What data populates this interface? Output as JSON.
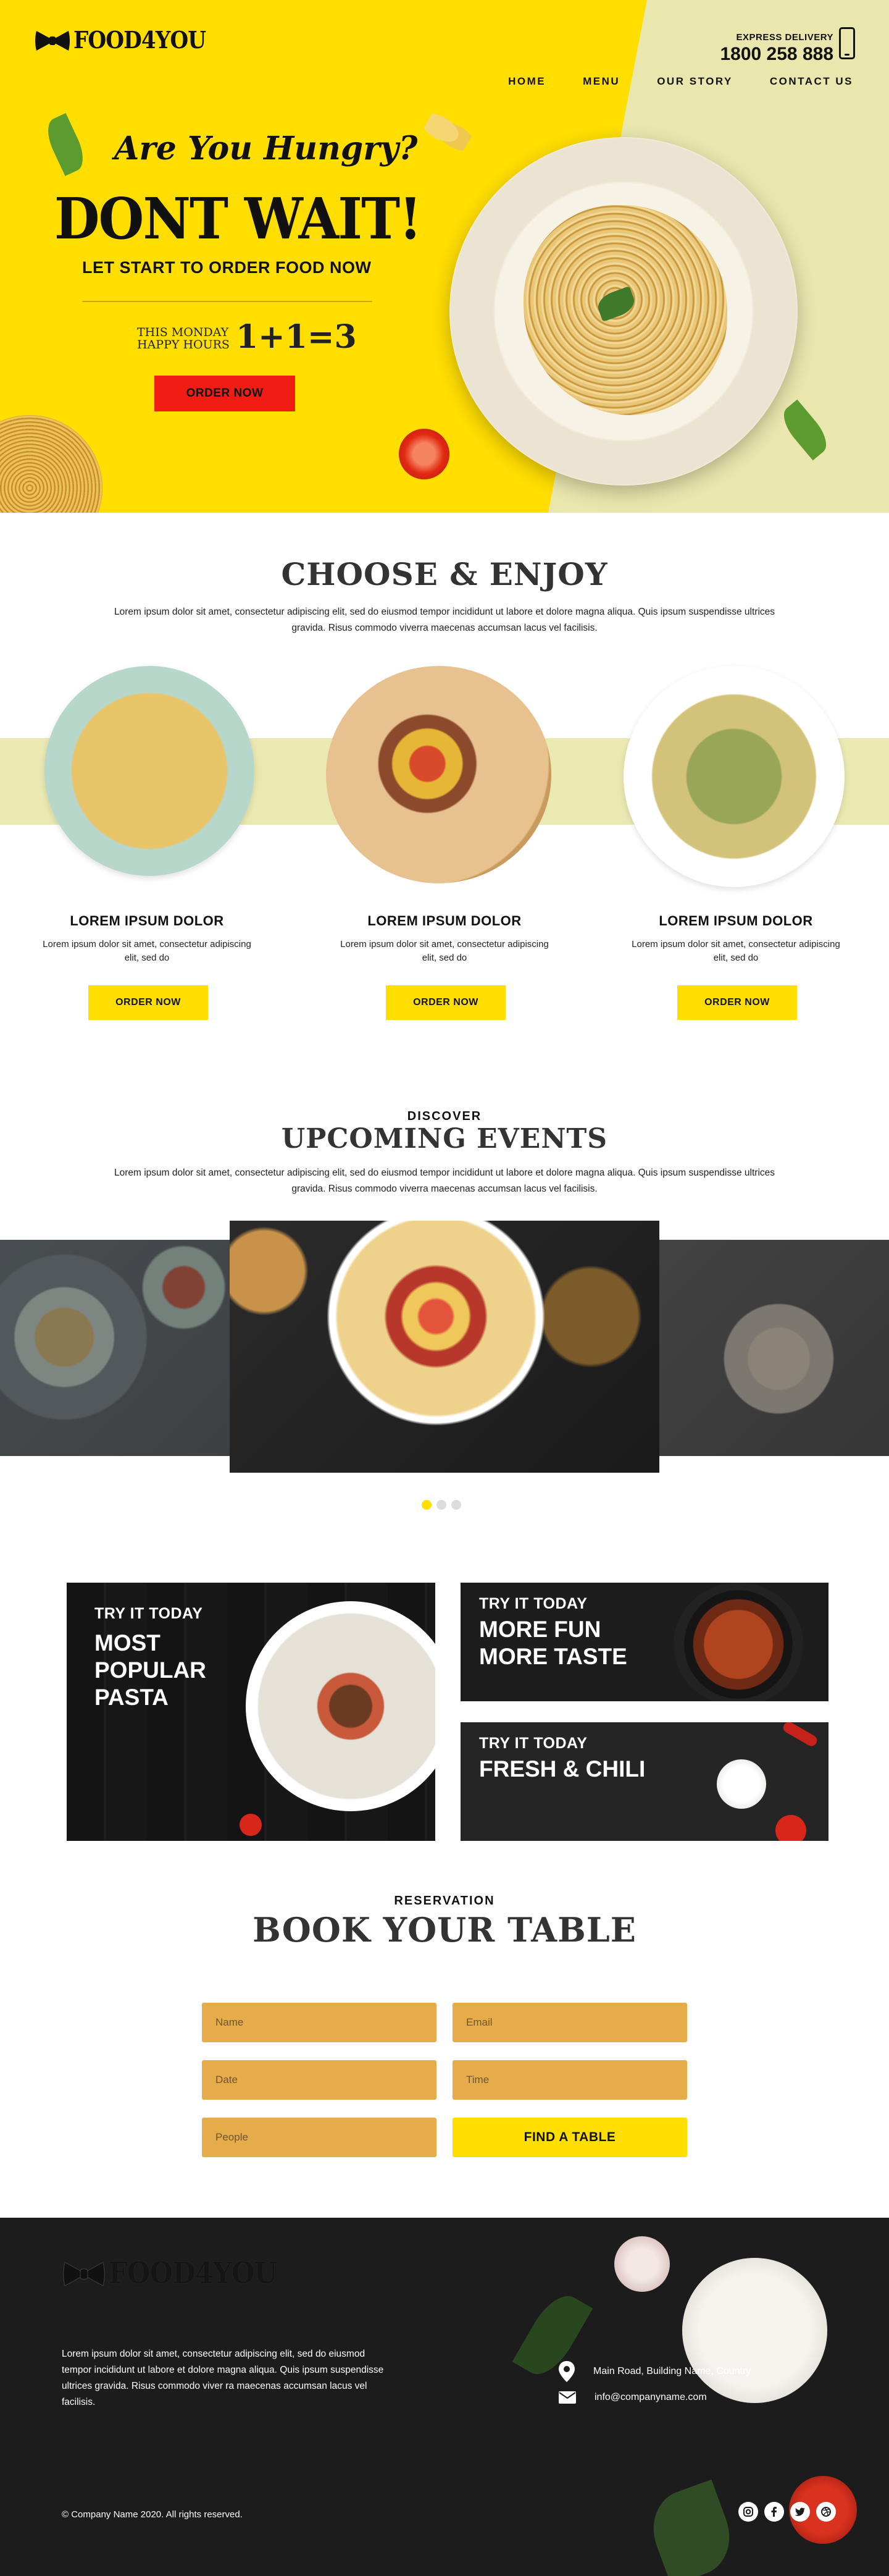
{
  "header": {
    "logo_text": "FOOD4YOU",
    "express_label": "EXPRESS DELIVERY",
    "express_phone": "1800 258 888",
    "nav": [
      "HOME",
      "MENU",
      "OUR STORY",
      "CONTACT US"
    ]
  },
  "hero": {
    "hungry": "Are You Hungry?",
    "dont_wait": "DONT WAIT!",
    "tagline": "LET START TO ORDER FOOD NOW",
    "monday_line1": "THIS MONDAY",
    "monday_line2": "HAPPY HOURS",
    "offer": "1+1=3",
    "button": "ORDER NOW"
  },
  "choose": {
    "title": "CHOOSE & ENJOY",
    "description": "Lorem ipsum dolor sit amet, consectetur adipiscing elit, sed do eiusmod tempor incididunt ut labore et dolore magna aliqua. Quis ipsum suspendisse ultrices gravida. Risus commodo viverra maecenas accumsan lacus vel facilisis.",
    "cards": [
      {
        "title": "LOREM IPSUM DOLOR",
        "description": "Lorem ipsum dolor sit amet, consectetur adipiscing elit, sed do",
        "button": "ORDER NOW"
      },
      {
        "title": "LOREM IPSUM DOLOR",
        "description": "Lorem ipsum dolor sit amet, consectetur adipiscing elit, sed do",
        "button": "ORDER NOW"
      },
      {
        "title": "LOREM IPSUM DOLOR",
        "description": "Lorem ipsum dolor sit amet, consectetur adipiscing elit, sed do",
        "button": "ORDER NOW"
      }
    ]
  },
  "events": {
    "kicker": "DISCOVER",
    "title": "UPCOMING EVENTS",
    "description": "Lorem ipsum dolor sit amet, consectetur adipiscing elit, sed do eiusmod tempor incididunt ut labore et dolore magna aliqua. Quis ipsum suspendisse ultrices gravida. Risus commodo viverra maecenas accumsan lacus vel facilisis."
  },
  "promos": {
    "pasta": {
      "kicker": "TRY IT TODAY",
      "line1": "MOST",
      "line2": "POPULAR",
      "line3": "PASTA"
    },
    "fun": {
      "kicker": "TRY IT TODAY",
      "line1": "MORE FUN",
      "line2": "MORE TASTE"
    },
    "chili": {
      "kicker": "TRY IT TODAY",
      "line1": "FRESH & CHILI"
    }
  },
  "reservation": {
    "kicker": "RESERVATION",
    "title": "BOOK YOUR TABLE",
    "name_placeholder": "Name",
    "email_placeholder": "Email",
    "date_placeholder": "Date",
    "time_placeholder": "Time",
    "people_placeholder": "People",
    "button": "FIND A TABLE"
  },
  "footer": {
    "logo_text": "FOOD4YOU",
    "description": "Lorem ipsum dolor sit amet, consectetur adipiscing elit, sed do eiusmod tempor incididunt ut labore et dolore magna aliqua. Quis ipsum suspendisse ultrices gravida. Risus commodo viver ra maecenas accumsan lacus vel facilisis.",
    "address": "Main Road, Building Name, Country",
    "email": "info@companyname.com",
    "copyright": "© Company Name 2020. All rights reserved.",
    "socials": [
      "instagram-icon",
      "facebook-icon",
      "twitter-icon",
      "dribbble-icon"
    ]
  },
  "colors": {
    "brand_yellow": "#ffde00",
    "hero_pale": "#e9e7ae",
    "accent_red": "#f11c13",
    "form_orange": "#e7ac4a",
    "dark": "#1c1c1c"
  }
}
